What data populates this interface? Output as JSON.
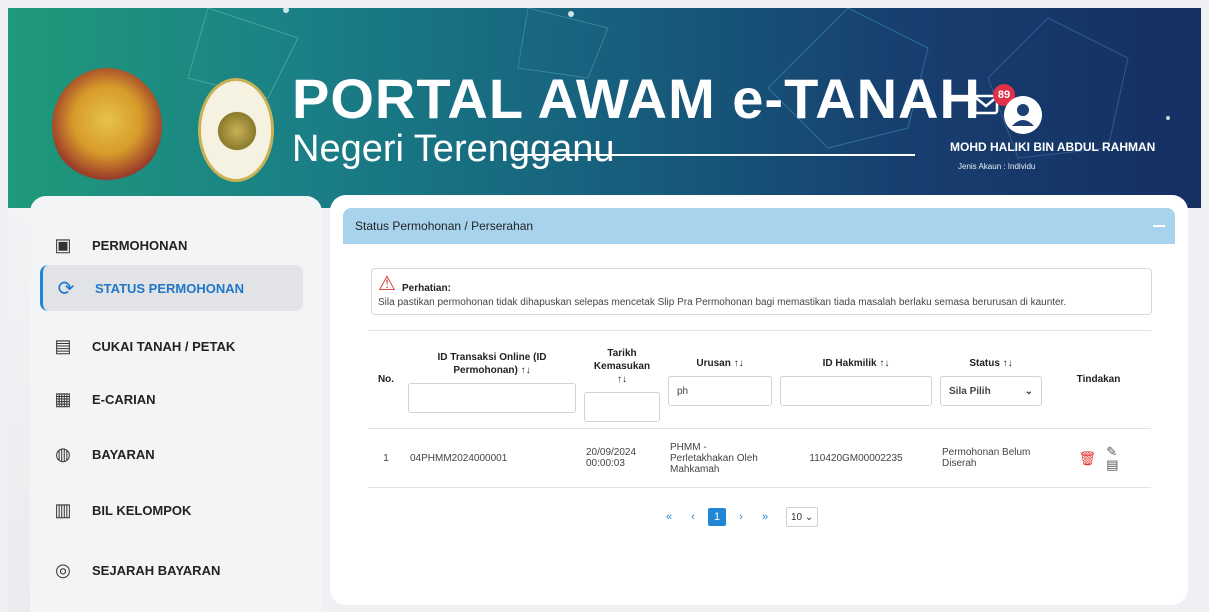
{
  "header": {
    "title": "PORTAL AWAM e-TANAH",
    "subtitle": "Negeri Terengganu",
    "notification_count": "89",
    "user_name": "MOHD HALIKI BIN ABDUL RAHMAN",
    "account_type": "Jenis Akaun : Individu"
  },
  "sidebar": {
    "items": [
      {
        "label": "PERMOHONAN",
        "icon": "certificate-icon"
      },
      {
        "label": "STATUS PERMOHONAN",
        "icon": "refresh-icon",
        "active": true
      },
      {
        "label": "CUKAI TANAH / PETAK",
        "icon": "tax-icon"
      },
      {
        "label": "E-CARIAN",
        "icon": "search-doc-icon"
      },
      {
        "label": "BAYARAN",
        "icon": "payment-icon"
      },
      {
        "label": "BIL KELOMPOK",
        "icon": "bill-icon"
      },
      {
        "label": "SEJARAH BAYARAN",
        "icon": "history-icon"
      }
    ]
  },
  "panel": {
    "title": "Status Permohonan / Perserahan"
  },
  "alert": {
    "heading": "Perhatian:",
    "message": "Sila pastikan permohonan tidak dihapuskan selepas mencetak Slip Pra Permohonan bagi memastikan tiada masalah berlaku semasa berurusan di kaunter."
  },
  "table": {
    "columns": {
      "no": "No.",
      "id_transaksi": "ID Transaksi Online (ID Permohonan)",
      "tarikh": "Tarikh Kemasukan",
      "urusan": "Urusan",
      "id_hakmilik": "ID Hakmilik",
      "status": "Status",
      "tindakan": "Tindakan"
    },
    "sort_glyph": "↑↓",
    "filters": {
      "urusan_value": "ph",
      "status_selected": "Sila Pilih"
    },
    "rows": [
      {
        "no": "1",
        "id_transaksi": "04PHMM2024000001",
        "tarikh_date": "20/09/2024",
        "tarikh_time": "00:00:03",
        "urusan": "PHMM - Perletakhakan Oleh Mahkamah",
        "id_hakmilik": "110420GM00002235",
        "status": "Permohonan Belum Diserah"
      }
    ]
  },
  "pagination": {
    "first": "«",
    "prev": "‹",
    "current": "1",
    "next": "›",
    "last": "»",
    "page_size": "10"
  },
  "colors": {
    "accent": "#1e88d6",
    "panel_header": "#a8d3ec",
    "danger": "#e3342f"
  }
}
